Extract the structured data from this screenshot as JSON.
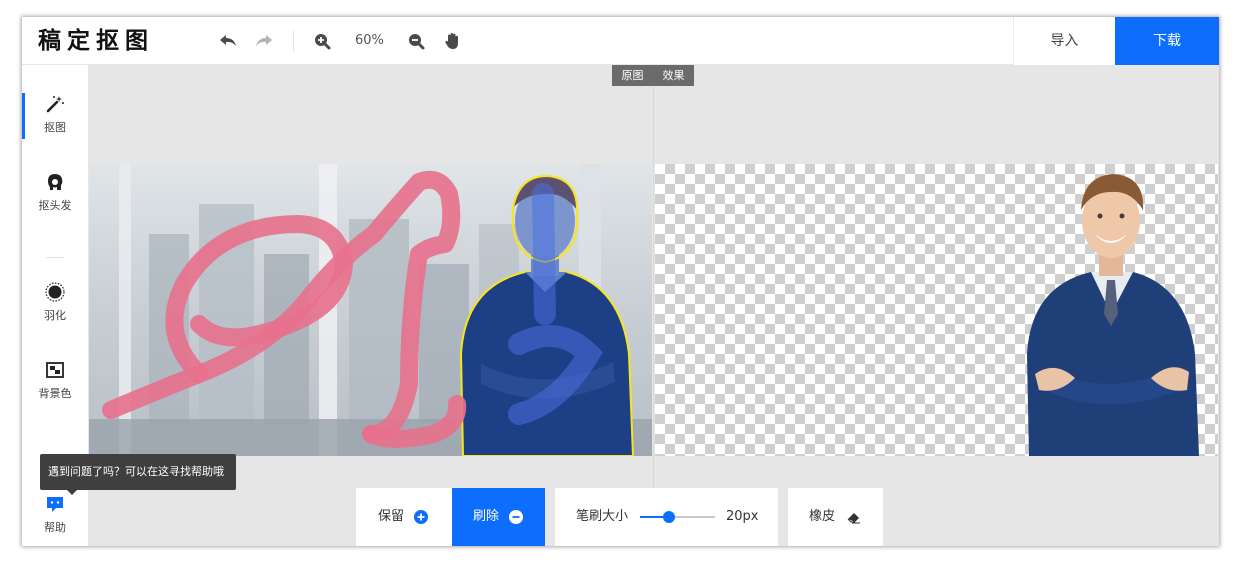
{
  "app": {
    "title": "稿定抠图"
  },
  "toolbar": {
    "zoom_level": "60%",
    "icons": [
      "undo-icon",
      "redo-icon",
      "zoom-in-icon",
      "zoom-out-icon",
      "hand-icon"
    ],
    "import_label": "导入",
    "download_label": "下载"
  },
  "sidebar": {
    "items": [
      {
        "label": "抠图",
        "icon": "magic-wand-icon",
        "active": true
      },
      {
        "label": "抠头发",
        "icon": "hair-icon",
        "active": false
      },
      {
        "label": "羽化",
        "icon": "feather-icon",
        "active": false
      },
      {
        "label": "背景色",
        "icon": "background-color-icon",
        "active": false
      }
    ],
    "help_label": "帮助",
    "help_tooltip": "遇到问题了吗？可以在这寻找帮助哦"
  },
  "compare": {
    "original_label": "原图",
    "result_label": "效果"
  },
  "tools": {
    "keep_label": "保留",
    "erase_label": "刷除",
    "brush_size_label": "笔刷大小",
    "brush_size_value": "20px",
    "brush_size_fraction": 0.38,
    "eraser_label": "橡皮"
  },
  "colors": {
    "accent": "#0d6efd",
    "keep_stroke": "#4a6fe0",
    "erase_stroke": "#e8708c",
    "selection_outline": "#f5e51b",
    "suit": "#1e3f7a"
  }
}
